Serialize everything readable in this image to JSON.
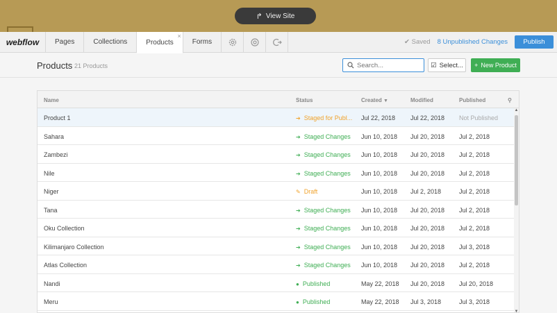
{
  "view_site": {
    "label": "View Site"
  },
  "nav": {
    "logo": "webflow",
    "tabs": [
      {
        "label": "Pages"
      },
      {
        "label": "Collections"
      },
      {
        "label": "Products"
      },
      {
        "label": "Forms"
      }
    ],
    "saved": "Saved",
    "unpublished": "8 Unpublished Changes",
    "publish": "Publish"
  },
  "header": {
    "title": "Products",
    "count": "21 Products",
    "search_placeholder": "Search...",
    "select_label": "Select...",
    "new_label": "New Product"
  },
  "table": {
    "columns": {
      "name": "Name",
      "status": "Status",
      "created": "Created",
      "modified": "Modified",
      "published": "Published"
    },
    "rows": [
      {
        "name": "Product 1",
        "status": "Staged for Publ...",
        "status_kind": "orange",
        "created": "Jul 22, 2018",
        "modified": "Jul 22, 2018",
        "published": "Not Published"
      },
      {
        "name": "Sahara",
        "status": "Staged Changes",
        "status_kind": "green",
        "created": "Jun 10, 2018",
        "modified": "Jul 20, 2018",
        "published": "Jul 2, 2018"
      },
      {
        "name": "Zambezi",
        "status": "Staged Changes",
        "status_kind": "green",
        "created": "Jun 10, 2018",
        "modified": "Jul 20, 2018",
        "published": "Jul 2, 2018"
      },
      {
        "name": "Nile",
        "status": "Staged Changes",
        "status_kind": "green",
        "created": "Jun 10, 2018",
        "modified": "Jul 20, 2018",
        "published": "Jul 2, 2018"
      },
      {
        "name": "Niger",
        "status": "Draft",
        "status_kind": "orange",
        "created": "Jun 10, 2018",
        "modified": "Jul 2, 2018",
        "published": "Jul 2, 2018"
      },
      {
        "name": "Tana",
        "status": "Staged Changes",
        "status_kind": "green",
        "created": "Jun 10, 2018",
        "modified": "Jul 20, 2018",
        "published": "Jul 2, 2018"
      },
      {
        "name": "Oku Collection",
        "status": "Staged Changes",
        "status_kind": "green",
        "created": "Jun 10, 2018",
        "modified": "Jul 20, 2018",
        "published": "Jul 2, 2018"
      },
      {
        "name": "Kilimanjaro Collection",
        "status": "Staged Changes",
        "status_kind": "green",
        "created": "Jun 10, 2018",
        "modified": "Jul 20, 2018",
        "published": "Jul 3, 2018"
      },
      {
        "name": "Atlas Collection",
        "status": "Staged Changes",
        "status_kind": "green",
        "created": "Jun 10, 2018",
        "modified": "Jul 20, 2018",
        "published": "Jul 2, 2018"
      },
      {
        "name": "Nandi",
        "status": "Published",
        "status_kind": "green",
        "created": "May 22, 2018",
        "modified": "Jul 20, 2018",
        "published": "Jul 20, 2018"
      },
      {
        "name": "Meru",
        "status": "Published",
        "status_kind": "green",
        "created": "May 22, 2018",
        "modified": "Jul 3, 2018",
        "published": "Jul 3, 2018"
      }
    ]
  },
  "colors": {
    "accent": "#3b8fd9",
    "success": "#3fae54",
    "warning": "#f0a22a"
  }
}
